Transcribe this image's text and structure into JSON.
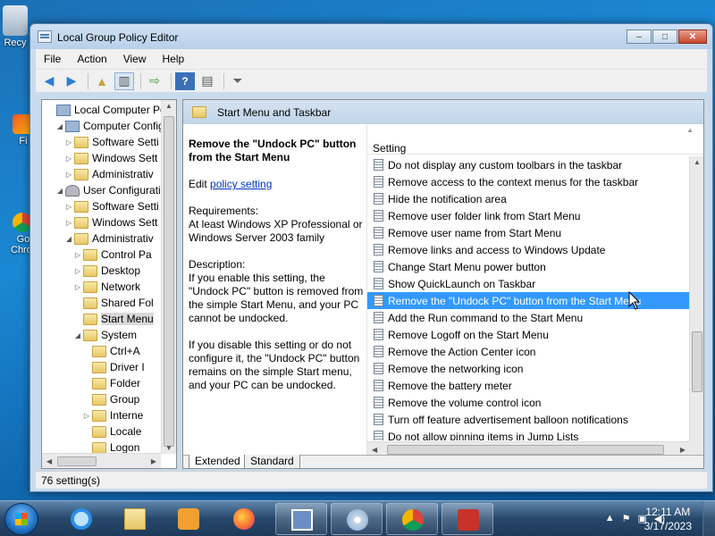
{
  "desktop": {
    "icons": [
      {
        "label": "Recy",
        "icon": "recycle-bin-icon"
      },
      {
        "label": "Fi",
        "icon": "app-icon"
      },
      {
        "label": "Go",
        "icon": "chrome-icon",
        "label2": "Chro"
      }
    ]
  },
  "window": {
    "title": "Local Group Policy Editor",
    "caption": {
      "minimize": "‒",
      "maximize": "□",
      "close": "✕"
    }
  },
  "menu": [
    "File",
    "Action",
    "View",
    "Help"
  ],
  "tree": {
    "items": [
      {
        "label": "Local Computer Polic",
        "icon": "policy",
        "expander": ""
      },
      {
        "label": "Computer Config",
        "icon": "pc",
        "expander": "◢"
      },
      {
        "label": "Software Setti",
        "icon": "folder",
        "expander": "▷"
      },
      {
        "label": "Windows Sett",
        "icon": "folder",
        "expander": "▷"
      },
      {
        "label": "Administrativ",
        "icon": "folder",
        "expander": "▷"
      },
      {
        "label": "User Configuratio",
        "icon": "user",
        "expander": "◢"
      },
      {
        "label": "Software Setti",
        "icon": "folder",
        "expander": "▷"
      },
      {
        "label": "Windows Sett",
        "icon": "folder",
        "expander": "▷"
      },
      {
        "label": "Administrativ",
        "icon": "folder",
        "expander": "◢"
      },
      {
        "label": "Control Pa",
        "icon": "folder",
        "expander": "▷"
      },
      {
        "label": "Desktop",
        "icon": "folder",
        "expander": "▷"
      },
      {
        "label": "Network",
        "icon": "folder",
        "expander": "▷"
      },
      {
        "label": "Shared Fol",
        "icon": "folder",
        "expander": ""
      },
      {
        "label": "Start Menu",
        "icon": "folder",
        "expander": "",
        "selected": true
      },
      {
        "label": "System",
        "icon": "folder",
        "expander": "◢"
      },
      {
        "label": "Ctrl+A",
        "icon": "folder",
        "expander": ""
      },
      {
        "label": "Driver I",
        "icon": "folder",
        "expander": ""
      },
      {
        "label": "Folder",
        "icon": "folder",
        "expander": ""
      },
      {
        "label": "Group",
        "icon": "folder",
        "expander": ""
      },
      {
        "label": "Interne",
        "icon": "folder",
        "expander": "▷"
      },
      {
        "label": "Locale",
        "icon": "folder",
        "expander": ""
      },
      {
        "label": "Logon",
        "icon": "folder",
        "expander": ""
      }
    ]
  },
  "right": {
    "header": "Start Menu and Taskbar",
    "description": {
      "heading": "Remove the \"Undock PC\" button from the Start Menu",
      "edit_prefix": "Edit ",
      "edit_link": "policy setting",
      "requirements": "Requirements:\nAt least Windows XP Professional or Windows Server 2003 family",
      "description": "Description:\nIf you enable this setting, the \"Undock PC\" button is removed from the simple Start Menu, and your PC cannot be undocked.",
      "disable": "If you disable this setting or do not configure it, the \"Undock PC\" button remains on the simple Start menu, and your PC can be undocked."
    },
    "column_header": "Setting",
    "settings": [
      {
        "label": "Do not display any custom toolbars in the taskbar"
      },
      {
        "label": "Remove access to the context menus for the taskbar"
      },
      {
        "label": "Hide the notification area"
      },
      {
        "label": "Remove user folder link from Start Menu"
      },
      {
        "label": "Remove user name from Start Menu"
      },
      {
        "label": "Remove links and access to Windows Update"
      },
      {
        "label": "Change Start Menu power button"
      },
      {
        "label": "Show QuickLaunch on Taskbar"
      },
      {
        "label": "Remove the \"Undock PC\" button from the Start Menu",
        "selected": true
      },
      {
        "label": "Add the Run command to the Start Menu"
      },
      {
        "label": "Remove Logoff on the Start Menu"
      },
      {
        "label": "Remove the Action Center icon"
      },
      {
        "label": "Remove the networking icon"
      },
      {
        "label": "Remove the battery meter"
      },
      {
        "label": "Remove the volume control icon"
      },
      {
        "label": "Turn off feature advertisement balloon notifications"
      },
      {
        "label": "Do not allow pinning items in Jump Lists"
      }
    ],
    "tabs": [
      "Extended",
      "Standard"
    ]
  },
  "status": "76 setting(s)",
  "taskbar": {
    "apps": [
      "internet-explorer",
      "file-explorer",
      "media-player",
      "firefox",
      "network-app",
      "disc-app",
      "chrome-app",
      "toolbox-app"
    ],
    "time": "12:11 AM",
    "date": "3/17/2023"
  },
  "colors": {
    "selection": "#3399ff",
    "link": "#0033cc"
  }
}
